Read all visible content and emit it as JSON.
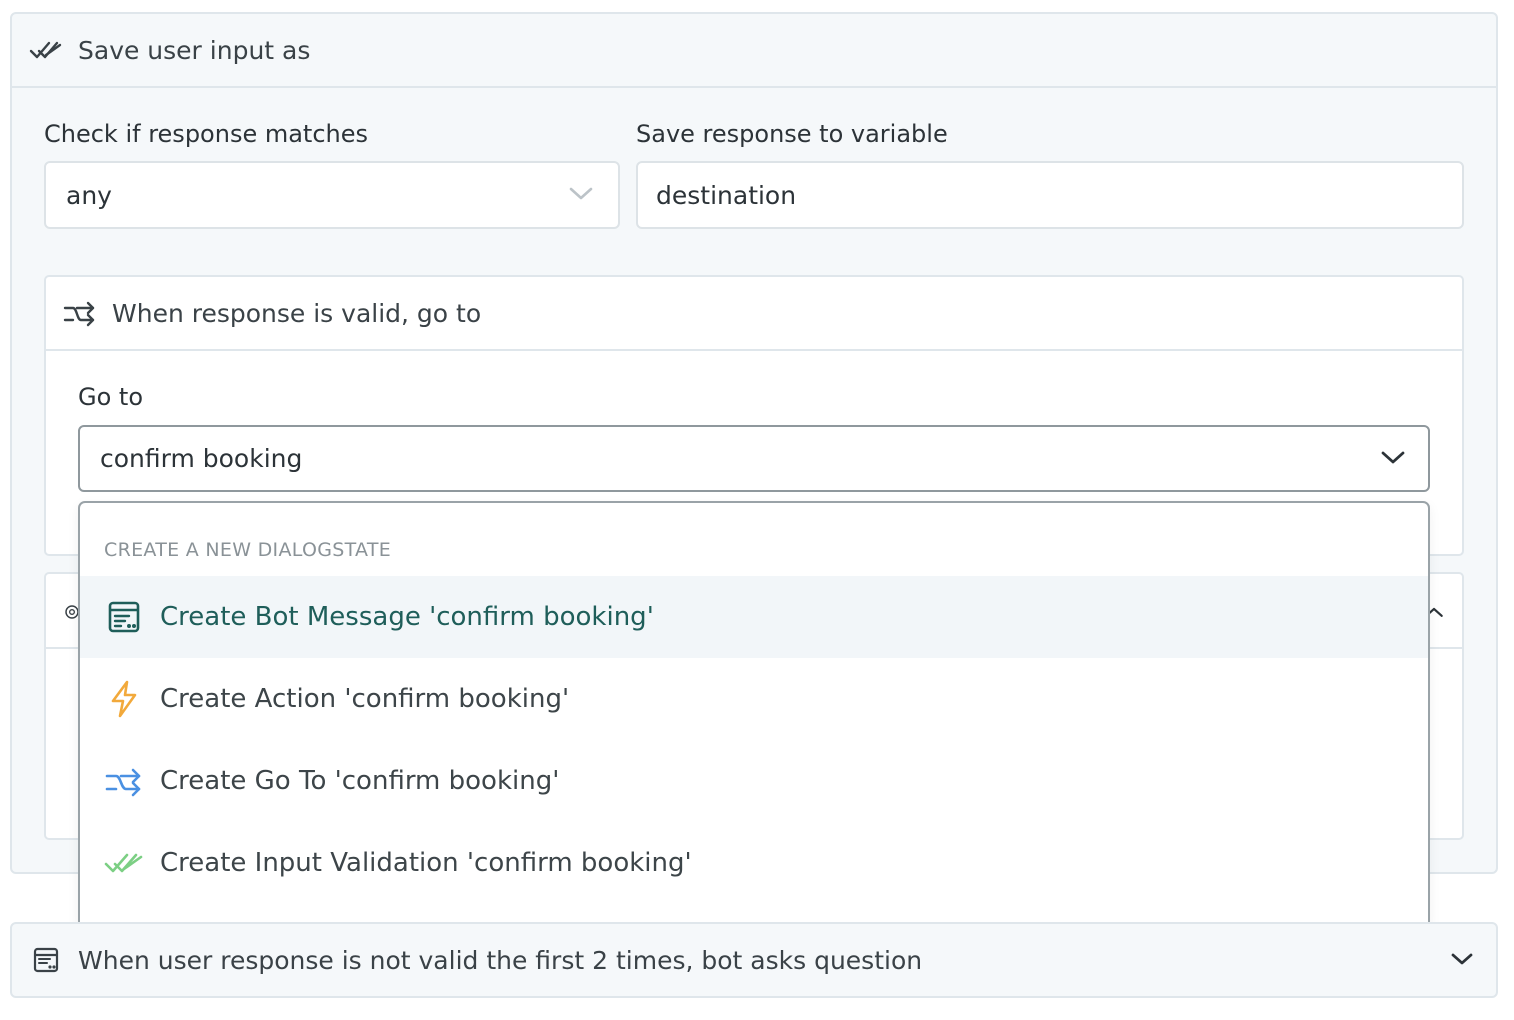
{
  "save_panel": {
    "title": "Save user input as",
    "check_label": "Check if response matches",
    "check_value": "any",
    "variable_label": "Save response to variable",
    "variable_value": "destination"
  },
  "valid_section": {
    "title": "When response is valid, go to",
    "goto_label": "Go to",
    "goto_value": "confirm booking"
  },
  "dropdown": {
    "heading": "CREATE A NEW DIALOGSTATE",
    "items": [
      {
        "label": "Create Bot Message 'confirm booking'",
        "icon": "bot-message-icon",
        "color": "#1f5e5a"
      },
      {
        "label": "Create Action 'confirm booking'",
        "icon": "lightning-icon",
        "color": "#f2a93b"
      },
      {
        "label": "Create Go To 'confirm booking'",
        "icon": "goto-arrows-icon",
        "color": "#4a90e2"
      },
      {
        "label": "Create Input Validation 'confirm booking'",
        "icon": "double-check-icon",
        "color": "#7ccf84"
      }
    ]
  },
  "invalid_panel": {
    "title": "When user response is not valid the first 2 times, bot asks question"
  }
}
